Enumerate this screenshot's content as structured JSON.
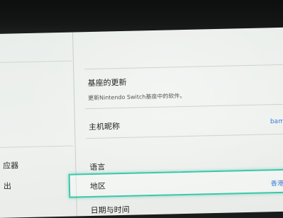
{
  "sidebar": {
    "items": [
      "应器",
      "出"
    ]
  },
  "settings": {
    "console_update": {
      "label": "基座的更新",
      "description": "更新Nintendo Switch基座中的软件。"
    },
    "console_nickname": {
      "label": "主机昵称",
      "value": "bam"
    },
    "language": {
      "label": "语言"
    },
    "region": {
      "label": "地区",
      "value": "香港/"
    },
    "date_time": {
      "label": "日期与时间"
    }
  },
  "colors": {
    "accent_highlight": "#3cc7a9",
    "value_text": "#3a7fd6"
  }
}
